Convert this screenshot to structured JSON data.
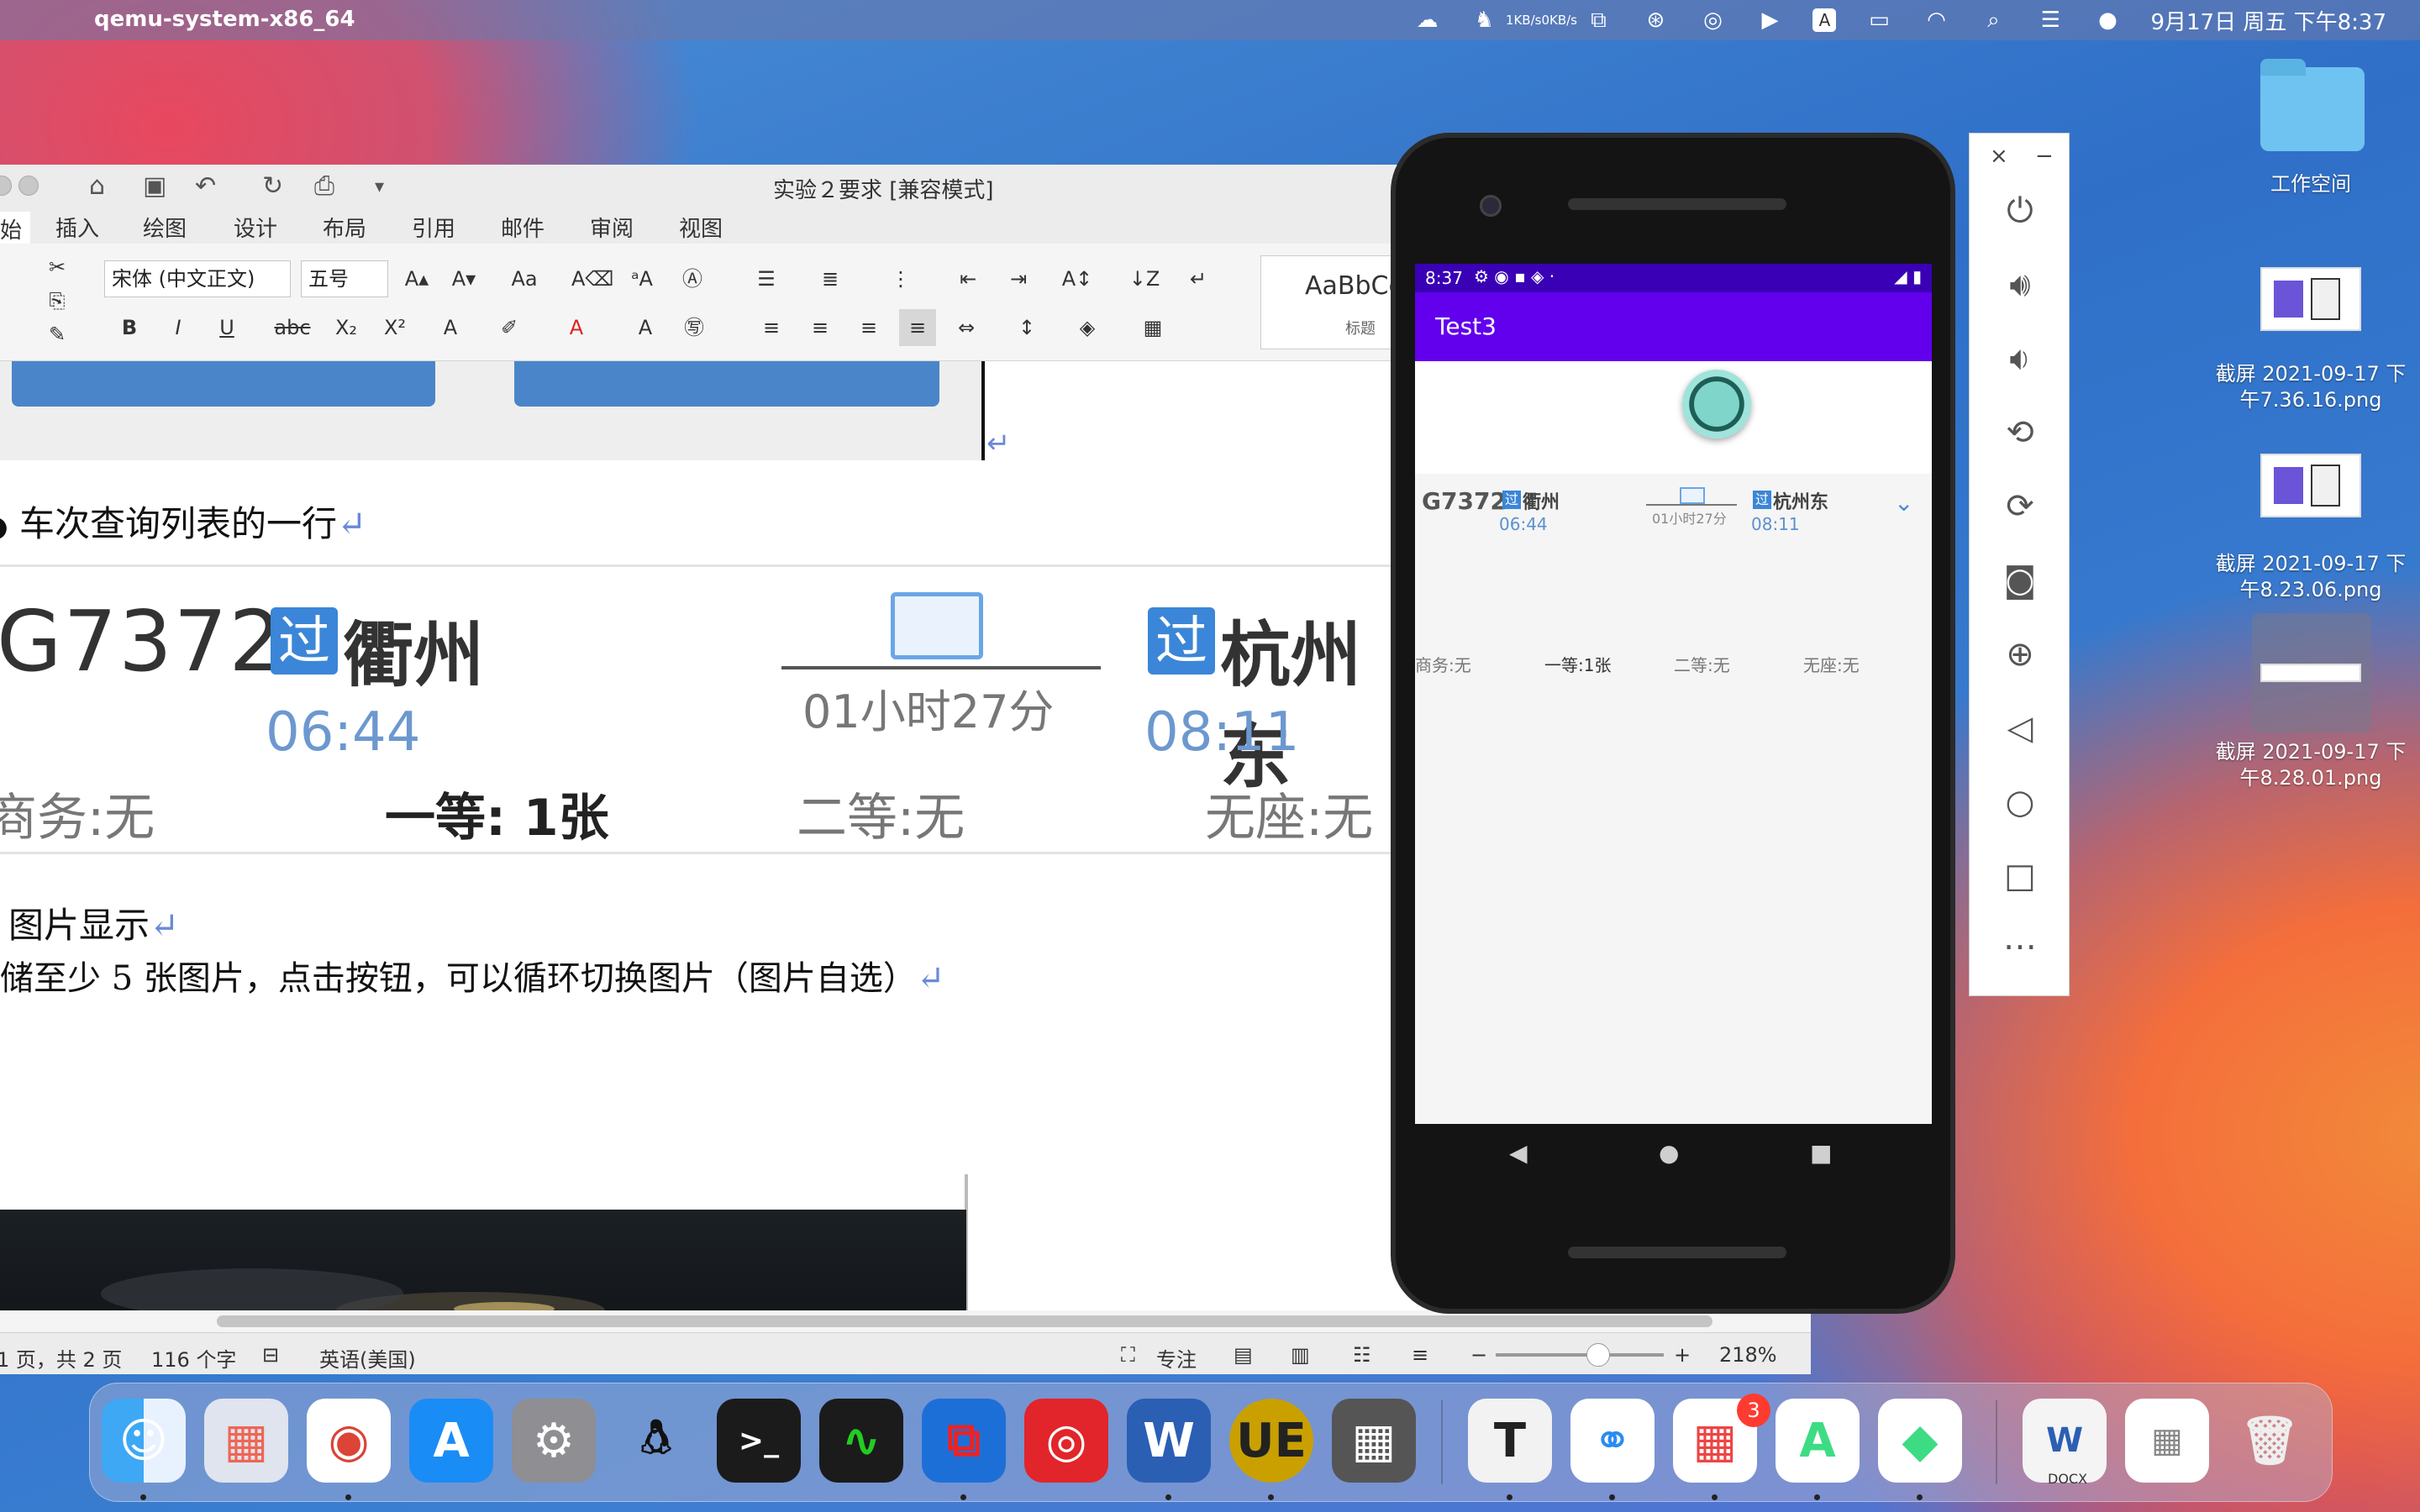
{
  "menubar": {
    "app_name": "qemu-system-x86_64",
    "net_up": "1KB/s",
    "net_down": "0KB/s",
    "input_method": "A",
    "clock": "9月17日 周五 下午8:37"
  },
  "word": {
    "doc_title": "实验２要求 [兼容模式]",
    "tabs": [
      "始",
      "插入",
      "绘图",
      "设计",
      "布局",
      "引用",
      "邮件",
      "审阅",
      "视图"
    ],
    "active_tab_index": 0,
    "ribbon": {
      "font_name": "宋体 (中文正文)",
      "font_size": "五号",
      "style_sample": "AaBbCc",
      "style_label": "标题"
    },
    "content": {
      "heading1": "车次查询列表的一行",
      "figure": {
        "train": "G7372",
        "pass_mark": "过",
        "from_station": "衢州",
        "from_time": "06:44",
        "duration": "01小时27分",
        "to_station": "杭州东",
        "to_time": "08:11",
        "seats": [
          "商务:无",
          "一等: 1张",
          "二等:无",
          "无座:无"
        ]
      },
      "heading2": "图片显示",
      "paragraph": "储至少 5 张图片，点击按钮，可以循环切换图片（图片自选）",
      "return_mark": "↵"
    },
    "statusbar": {
      "page": "1 页，共 2 页",
      "words": "116 个字",
      "language": "英语(美国)",
      "focus": "专注",
      "zoom": "218%"
    }
  },
  "emulator": {
    "status_time": "8:37",
    "app_title": "Test3",
    "row": {
      "train": "G7372",
      "pass_mark": "过",
      "from_station": "衢州",
      "from_time": "06:44",
      "duration": "01小时27分",
      "to_station": "杭州东",
      "to_time": "08:11",
      "seats": [
        "商务:无",
        "一等:1张",
        "二等:无",
        "无座:无"
      ]
    },
    "panel_buttons": [
      "power-icon",
      "volume-up-icon",
      "volume-down-icon",
      "rotate-left-icon",
      "rotate-right-icon",
      "camera-icon",
      "zoom-icon",
      "back-icon",
      "home-icon",
      "overview-icon",
      "more-icon"
    ]
  },
  "desktop_icons": [
    {
      "label": "工作空间"
    },
    {
      "label": "截屏 2021-09-17 下午7.36.16.png"
    },
    {
      "label": "截屏 2021-09-17 下午8.23.06.png"
    },
    {
      "label": "截屏 2021-09-17 下午8.28.01.png"
    }
  ],
  "dock": {
    "apps": [
      "Finder",
      "Launchpad",
      "Chrome",
      "App Store",
      "System Preferences",
      "QQ",
      "Terminal",
      "Activity Monitor",
      "Parallels",
      "NetEase Music",
      "Word",
      "UltraEdit",
      "Calculator",
      "Typora",
      "Baidu Netdisk",
      "Microsoft Store",
      "Android Studio",
      "Android File Transfer",
      "Documents",
      "Downloads",
      "Trash"
    ],
    "badge_count": "3",
    "doc_label": "DOCX"
  }
}
